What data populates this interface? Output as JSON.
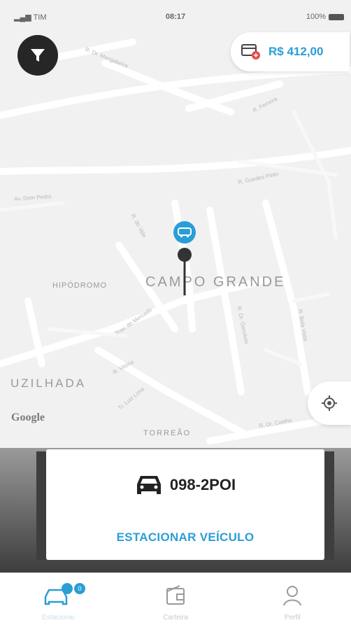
{
  "status_bar": {
    "carrier": "TIM",
    "time": "08:17",
    "battery": "100%"
  },
  "balance": {
    "amount": "R$ 412,00"
  },
  "map": {
    "areas": [
      "CAMPO GRANDE",
      "HIPÓDROMO",
      "UZILHADA",
      "TORREÃO"
    ],
    "attribution": "Google"
  },
  "vehicle": {
    "plate": "098-2POI",
    "action_label": "ESTACIONAR VEÍCULO"
  },
  "tabs": [
    {
      "label": "Estacionar",
      "active": true,
      "badge": "0"
    },
    {
      "label": "Carteira",
      "active": false
    },
    {
      "label": "Perfil",
      "active": false
    }
  ],
  "colors": {
    "accent": "#2a9ed6",
    "dark": "#262626",
    "alert": "#e84a4a"
  }
}
